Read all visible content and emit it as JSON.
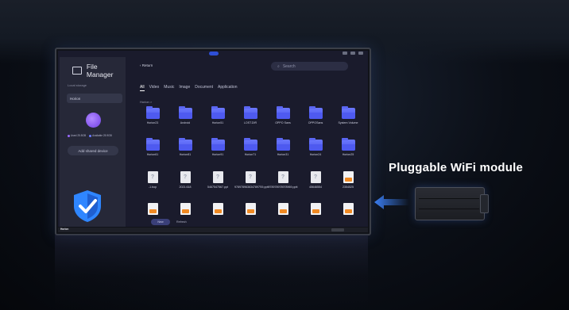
{
  "app": {
    "title": "File Manager",
    "return_label": "Return",
    "search_placeholder": "Search"
  },
  "sidebar": {
    "local_storage_label": "Local storage",
    "device_name": "Horion",
    "usage": {
      "used": "Used 25.5GB",
      "available": "Available 25.9GB",
      "used_color": "#9a6bff",
      "available_color": "#6b7bff"
    },
    "add_shared_label": "Add shared device"
  },
  "tabs": [
    "All",
    "Video",
    "Music",
    "Image",
    "Document",
    "Application"
  ],
  "breadcrumb": "Horion  >",
  "files": [
    {
      "type": "folder",
      "name": "Horion23"
    },
    {
      "type": "folder",
      "name": "Android"
    },
    {
      "type": "folder",
      "name": "Horion51"
    },
    {
      "type": "folder",
      "name": "LOST.DIR"
    },
    {
      "type": "folder",
      "name": "OPPO Sans"
    },
    {
      "type": "folder",
      "name": "OPPOSans"
    },
    {
      "type": "folder",
      "name": "System Volume"
    },
    {
      "type": "folder",
      "name": "Horion61"
    },
    {
      "type": "folder",
      "name": "Horion81"
    },
    {
      "type": "folder",
      "name": "Horion91"
    },
    {
      "type": "folder",
      "name": "Horion71"
    },
    {
      "type": "folder",
      "name": "Horion31"
    },
    {
      "type": "folder",
      "name": "Horion24"
    },
    {
      "type": "folder",
      "name": "Horion25"
    },
    {
      "type": "doc",
      "name": "-1.bop"
    },
    {
      "type": "doc",
      "name": "2021.618"
    },
    {
      "type": "doc",
      "name": "5467547567.ppt"
    },
    {
      "type": "doc",
      "name": "9789789636347897S9.pptt"
    },
    {
      "type": "doc",
      "name": "978978978978969.pptt"
    },
    {
      "type": "doc",
      "name": "45646554"
    },
    {
      "type": "ppt",
      "name": "2354525"
    },
    {
      "type": "ppt",
      "name": ""
    },
    {
      "type": "ppt",
      "name": ""
    },
    {
      "type": "ppt",
      "name": ""
    },
    {
      "type": "ppt",
      "name": ""
    },
    {
      "type": "ppt",
      "name": ""
    },
    {
      "type": "ppt",
      "name": ""
    },
    {
      "type": "ppt",
      "name": ""
    }
  ],
  "buttons": {
    "new": "New",
    "refresh": "Refresh"
  },
  "bezel_brand": "Horion",
  "feature_text": "Pluggable WiFi module",
  "colors": {
    "accent_folder": "#5a66f2",
    "shield": "#2f86ff",
    "arrow": "#2f6fe0"
  }
}
